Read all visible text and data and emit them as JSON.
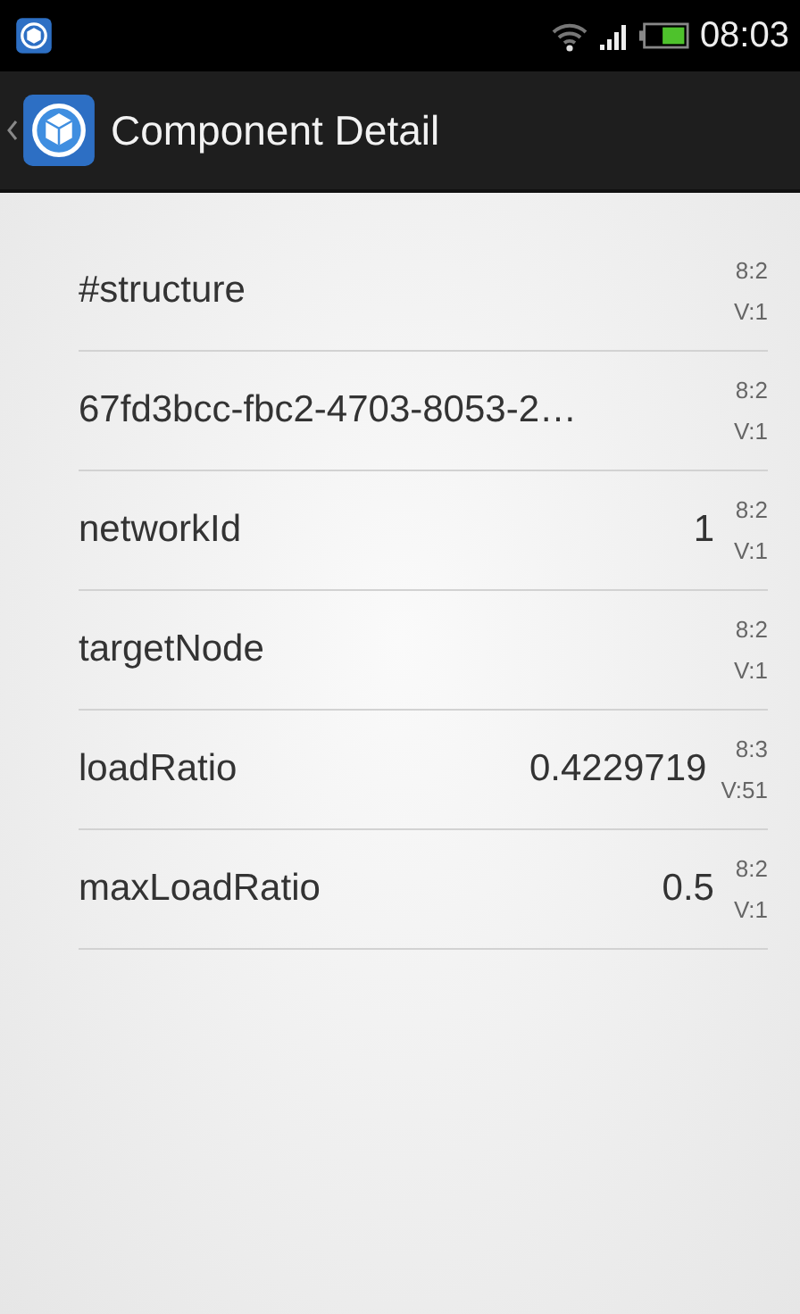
{
  "status_bar": {
    "time": "08:03"
  },
  "action_bar": {
    "title": "Component Detail"
  },
  "properties": [
    {
      "name": "#structure",
      "line_1": "8:2",
      "line_2": "V:1"
    },
    {
      "name": "67fd3bcc-fbc2-4703-8053-2…",
      "line_1": "8:2",
      "line_2": "V:1"
    },
    {
      "name": "networkId",
      "value": "1",
      "line_1": "8:2",
      "line_2": "V:1"
    },
    {
      "name": "targetNode",
      "line_1": "8:2",
      "line_2": "V:1"
    },
    {
      "name": "loadRatio",
      "value": "0.4229719",
      "line_1": "8:3",
      "line_2": "V:51"
    },
    {
      "name": "maxLoadRatio",
      "value": "0.5",
      "line_1": "8:2",
      "line_2": "V:1"
    }
  ]
}
